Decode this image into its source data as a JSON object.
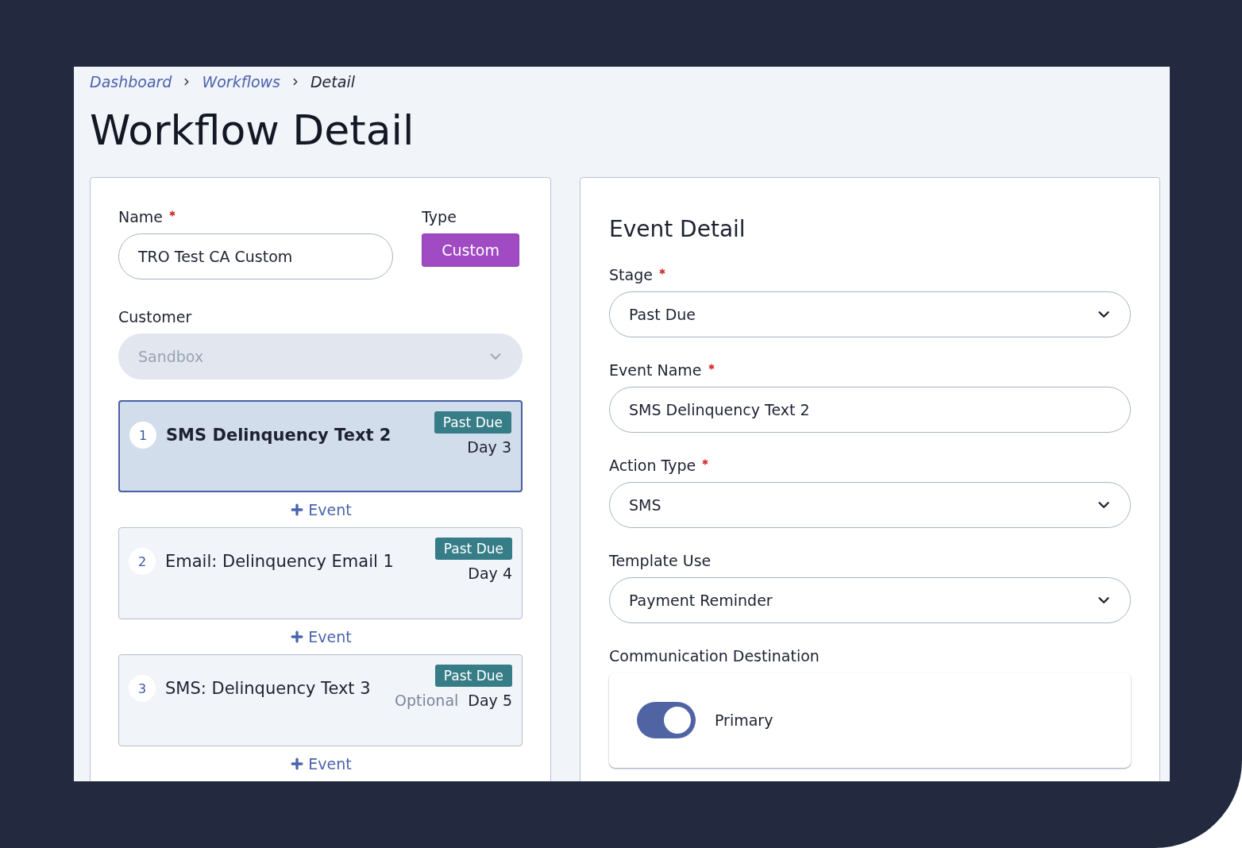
{
  "breadcrumb": [
    {
      "label": "Dashboard",
      "kind": "link"
    },
    {
      "label": "Workflows",
      "kind": "link"
    },
    {
      "label": "Detail",
      "kind": "current"
    }
  ],
  "title": "Workflow Detail",
  "workflow": {
    "name_label": "Name",
    "name_required": true,
    "name_value": "TRO Test CA Custom",
    "type_label": "Type",
    "type_value": "Custom",
    "customer_label": "Customer",
    "customer_value": "Sandbox",
    "customer_disabled": true
  },
  "events": [
    {
      "number": "1",
      "title": "SMS Delinquency Text 2",
      "selected": true,
      "stage": "Past Due",
      "day": "Day 3",
      "add_label": "Event"
    },
    {
      "number": "2",
      "title": "Email: Delinquency Email 1",
      "selected": false,
      "stage": "Past Due",
      "day": "Day 4",
      "add_label": "Event"
    },
    {
      "number": "3",
      "title": "SMS: Delinquency Text 3",
      "selected": false,
      "stage": "Past Due",
      "optional": "Optional",
      "day": "Day 5",
      "add_label": "Event"
    }
  ],
  "event_detail": {
    "title": "Event Detail",
    "fields": [
      {
        "label": "Stage",
        "required": true,
        "kind": "select",
        "value": "Past Due"
      },
      {
        "label": "Event Name",
        "required": true,
        "kind": "text",
        "value": "SMS Delinquency Text 2"
      },
      {
        "label": "Action Type",
        "required": true,
        "kind": "select",
        "value": "SMS"
      },
      {
        "label": "Template Use",
        "required": false,
        "kind": "select",
        "value": "Payment Reminder"
      }
    ],
    "destination": {
      "label": "Communication Destination",
      "options": [
        {
          "label": "Primary",
          "on": true
        }
      ]
    }
  }
}
